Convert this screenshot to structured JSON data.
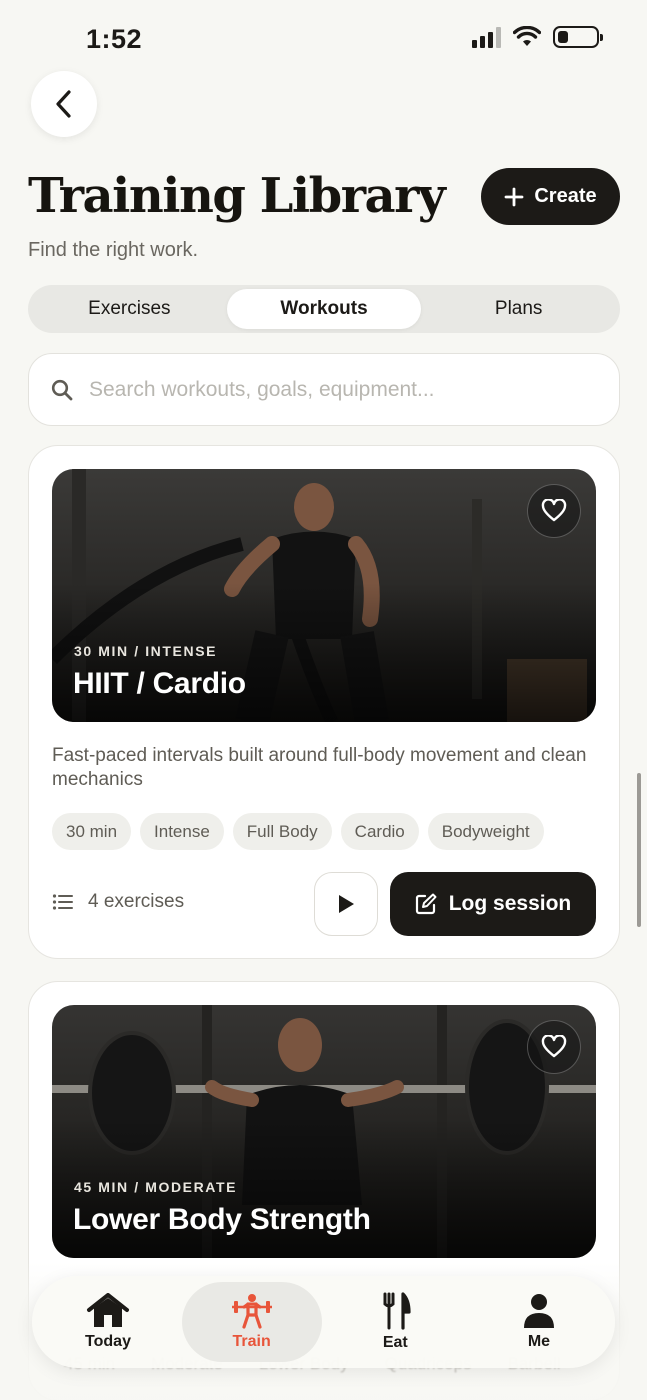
{
  "status_bar": {
    "time": "1:52"
  },
  "header": {
    "title": "Training Library",
    "subtitle": "Find the right work.",
    "create_label": "Create"
  },
  "tabs": [
    {
      "label": "Exercises",
      "active": false
    },
    {
      "label": "Workouts",
      "active": true
    },
    {
      "label": "Plans",
      "active": false
    }
  ],
  "search": {
    "placeholder": "Search workouts, goals, equipment...",
    "value": ""
  },
  "workouts": [
    {
      "meta": "30 MIN / INTENSE",
      "title": "HIIT / Cardio",
      "description": "Fast-paced intervals built around full-body movement and clean mechanics",
      "tags": [
        "30 min",
        "Intense",
        "Full Body",
        "Cardio",
        "Bodyweight"
      ],
      "exercise_count": "4 exercises",
      "log_label": "Log session"
    },
    {
      "meta": "45 MIN / MODERATE",
      "title": "Lower Body Strength",
      "tags": [
        "45 min",
        "Moderate",
        "Lower Body",
        "Quadriceps",
        "Barbell"
      ]
    }
  ],
  "bottom_nav": [
    {
      "label": "Today",
      "icon": "home-icon",
      "active": false
    },
    {
      "label": "Train",
      "icon": "barbell-person-icon",
      "active": true
    },
    {
      "label": "Eat",
      "icon": "fork-knife-icon",
      "active": false
    },
    {
      "label": "Me",
      "icon": "person-icon",
      "active": false
    }
  ],
  "colors": {
    "accent": "#e8553a",
    "dark": "#1c1a17",
    "background": "#f7f7f3"
  }
}
